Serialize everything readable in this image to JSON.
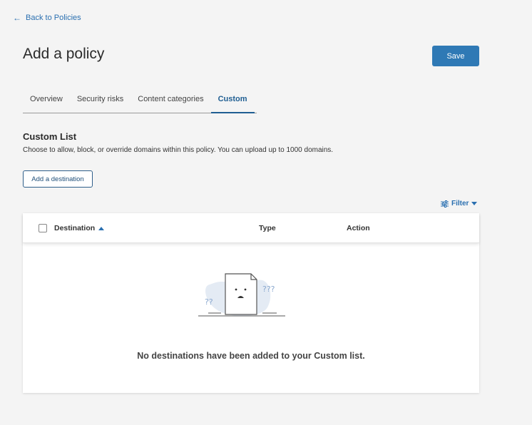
{
  "header": {
    "back_label": "Back to Policies",
    "title": "Add a policy",
    "save_label": "Save"
  },
  "tabs": [
    {
      "label": "Overview"
    },
    {
      "label": "Security risks"
    },
    {
      "label": "Content categories"
    },
    {
      "label": "Custom"
    }
  ],
  "active_tab": "Custom",
  "section": {
    "title": "Custom List",
    "description": "Choose to allow, block, or override domains within this policy. You can upload up to 1000 domains.",
    "add_button_label": "Add a destination"
  },
  "filter_label": "Filter",
  "table": {
    "columns": [
      "Destination",
      "Type",
      "Action"
    ],
    "sort_column": "Destination",
    "sort_direction": "ascending",
    "rows": []
  },
  "empty_state": {
    "message": "No destinations have been added to your Custom list."
  },
  "colors": {
    "accent": "#2f79b5",
    "link": "#2a6fb0",
    "background": "#f4f4f4"
  }
}
